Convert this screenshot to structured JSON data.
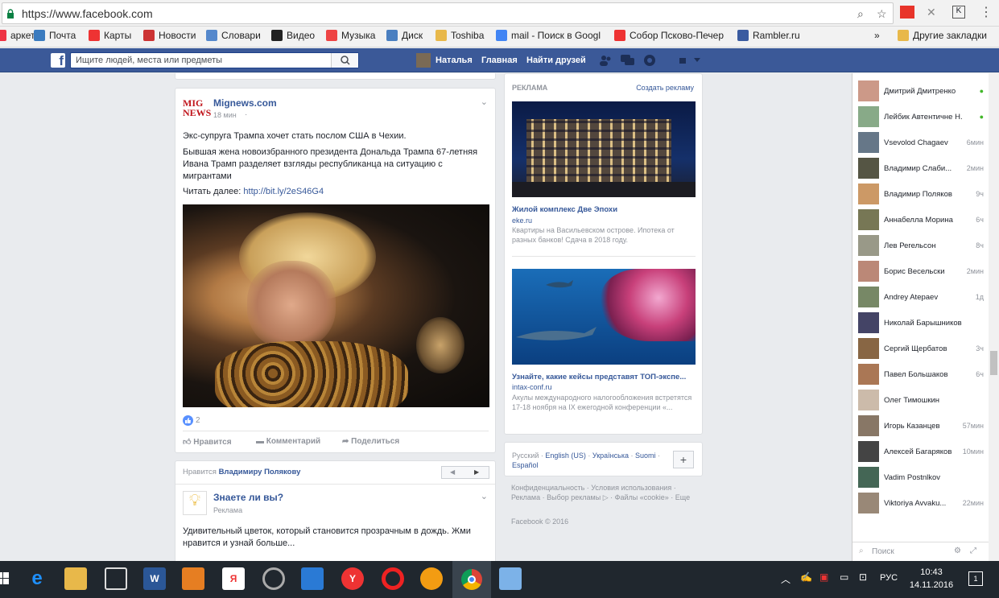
{
  "browser": {
    "url": "https://www.facebook.com"
  },
  "bookmarks": [
    {
      "label": "аркет",
      "color": "#e34"
    },
    {
      "label": "Почта",
      "color": "#3b7bbf"
    },
    {
      "label": "Карты",
      "color": "#e33"
    },
    {
      "label": "Новости",
      "color": "#c33"
    },
    {
      "label": "Словари",
      "color": "#5588cc"
    },
    {
      "label": "Видео",
      "color": "#222"
    },
    {
      "label": "Музыка",
      "color": "#e44"
    },
    {
      "label": "Диск",
      "color": "#4a7fc0"
    },
    {
      "label": "Toshiba",
      "color": "#e8b84a"
    },
    {
      "label": "mail - Поиск в Googl",
      "color": "#4285f4"
    },
    {
      "label": "Собор Псково-Печер",
      "color": "#e33"
    },
    {
      "label": "Rambler.ru",
      "color": "#3a5ba0"
    },
    {
      "label": "»",
      "color": ""
    },
    {
      "label": "Другие закладки",
      "color": "#e8b84a"
    }
  ],
  "fb_header": {
    "logo": "f",
    "search_placeholder": "Ищите людей, места или предметы",
    "user": "Наталья",
    "home": "Главная",
    "find_friends": "Найти друзей"
  },
  "post": {
    "source": "Mignews.com",
    "logo_text_1": "MIG",
    "logo_text_2": "NEWS",
    "time": "18 мин",
    "privacy": "·",
    "headline": "Экс-супруга Трампа хочет стать послом США в Чехии.",
    "body": "Бывшая жена новоизбранного президента Дональда Трампа 67-летняя Ивана Трамп разделяет взгляды республиканца на ситуацию с мигрантами",
    "read_more_label": "Читать далее:",
    "read_more_link": "http://bit.ly/2eS46G4",
    "likes": "2",
    "like": "Нравится",
    "comment": "Комментарий",
    "share": "Поделиться"
  },
  "liked": {
    "prefix": "Нравится",
    "name": "Владимиру Полякову",
    "prev": "◀",
    "next": "▶"
  },
  "post2": {
    "title": "Знаете ли вы?",
    "sub": "Реклама",
    "body": "Удивительный цветок, который становится прозрачным в дождь. Жми нравится и узнай больше..."
  },
  "ads": {
    "header": "РЕКЛАМА",
    "create": "Создать рекламу",
    "items": [
      {
        "title": "Жилой комплекс Две Эпохи",
        "domain": "eke.ru",
        "text": "Квартиры на Васильевском острове. Ипотека от разных банков! Сдача в 2018 году."
      },
      {
        "title": "Узнайте, какие кейсы представят ТОП-экспе...",
        "domain": "intax-conf.ru",
        "text": "Акулы международного налогообложения встретятся 17-18 ноября на IX ежегодной конференции «..."
      }
    ]
  },
  "langs": {
    "items": [
      "Русский",
      "English (US)",
      "Українська",
      "Suomi",
      "Español"
    ],
    "plus": "+"
  },
  "footer": {
    "links": [
      "Конфиденциальность",
      "Условия использования",
      "Реклама",
      "Выбор рекламы",
      "Файлы «cookie»",
      "Еще"
    ],
    "copyright": "Facebook © 2016"
  },
  "chat": {
    "contacts": [
      {
        "name": "Дмитрий Дмитренко",
        "status": "●",
        "c": "#c98"
      },
      {
        "name": "Лейбик Автентичне Н...",
        "status": "●",
        "c": "#8a8"
      },
      {
        "name": "Vsevolod Chagaev",
        "status": "6мин",
        "c": "#678"
      },
      {
        "name": "Владимир Слаби...",
        "status": "2мин",
        "c": "#554"
      },
      {
        "name": "Владимир Поляков",
        "status": "9ч",
        "c": "#c96"
      },
      {
        "name": "Аннабелла Морина",
        "status": "6ч",
        "c": "#775"
      },
      {
        "name": "Лев Регельсон",
        "status": "8ч",
        "c": "#998"
      },
      {
        "name": "Борис Весельски",
        "status": "2мин",
        "c": "#b87"
      },
      {
        "name": "Andrey Atepaev",
        "status": "1д",
        "c": "#786"
      },
      {
        "name": "Николай Барышников",
        "status": "",
        "c": "#446"
      },
      {
        "name": "Сергий Щербатов",
        "status": "3ч",
        "c": "#864"
      },
      {
        "name": "Павел Большаков",
        "status": "6ч",
        "c": "#a75"
      },
      {
        "name": "Олег Тимошкин",
        "status": "",
        "c": "#cba"
      },
      {
        "name": "Игорь Казанцев",
        "status": "57мин",
        "c": "#876"
      },
      {
        "name": "Алексей Багаряков",
        "status": "10мин",
        "c": "#444"
      },
      {
        "name": "Vadim Postnlkov",
        "status": "",
        "c": "#465"
      },
      {
        "name": "Viktoriya Avvaku...",
        "status": "22мин",
        "c": "#987"
      }
    ],
    "search": "Поиск"
  },
  "taskbar": {
    "lang": "РУС",
    "time": "10:43",
    "date": "14.11.2016",
    "notif": "1"
  }
}
